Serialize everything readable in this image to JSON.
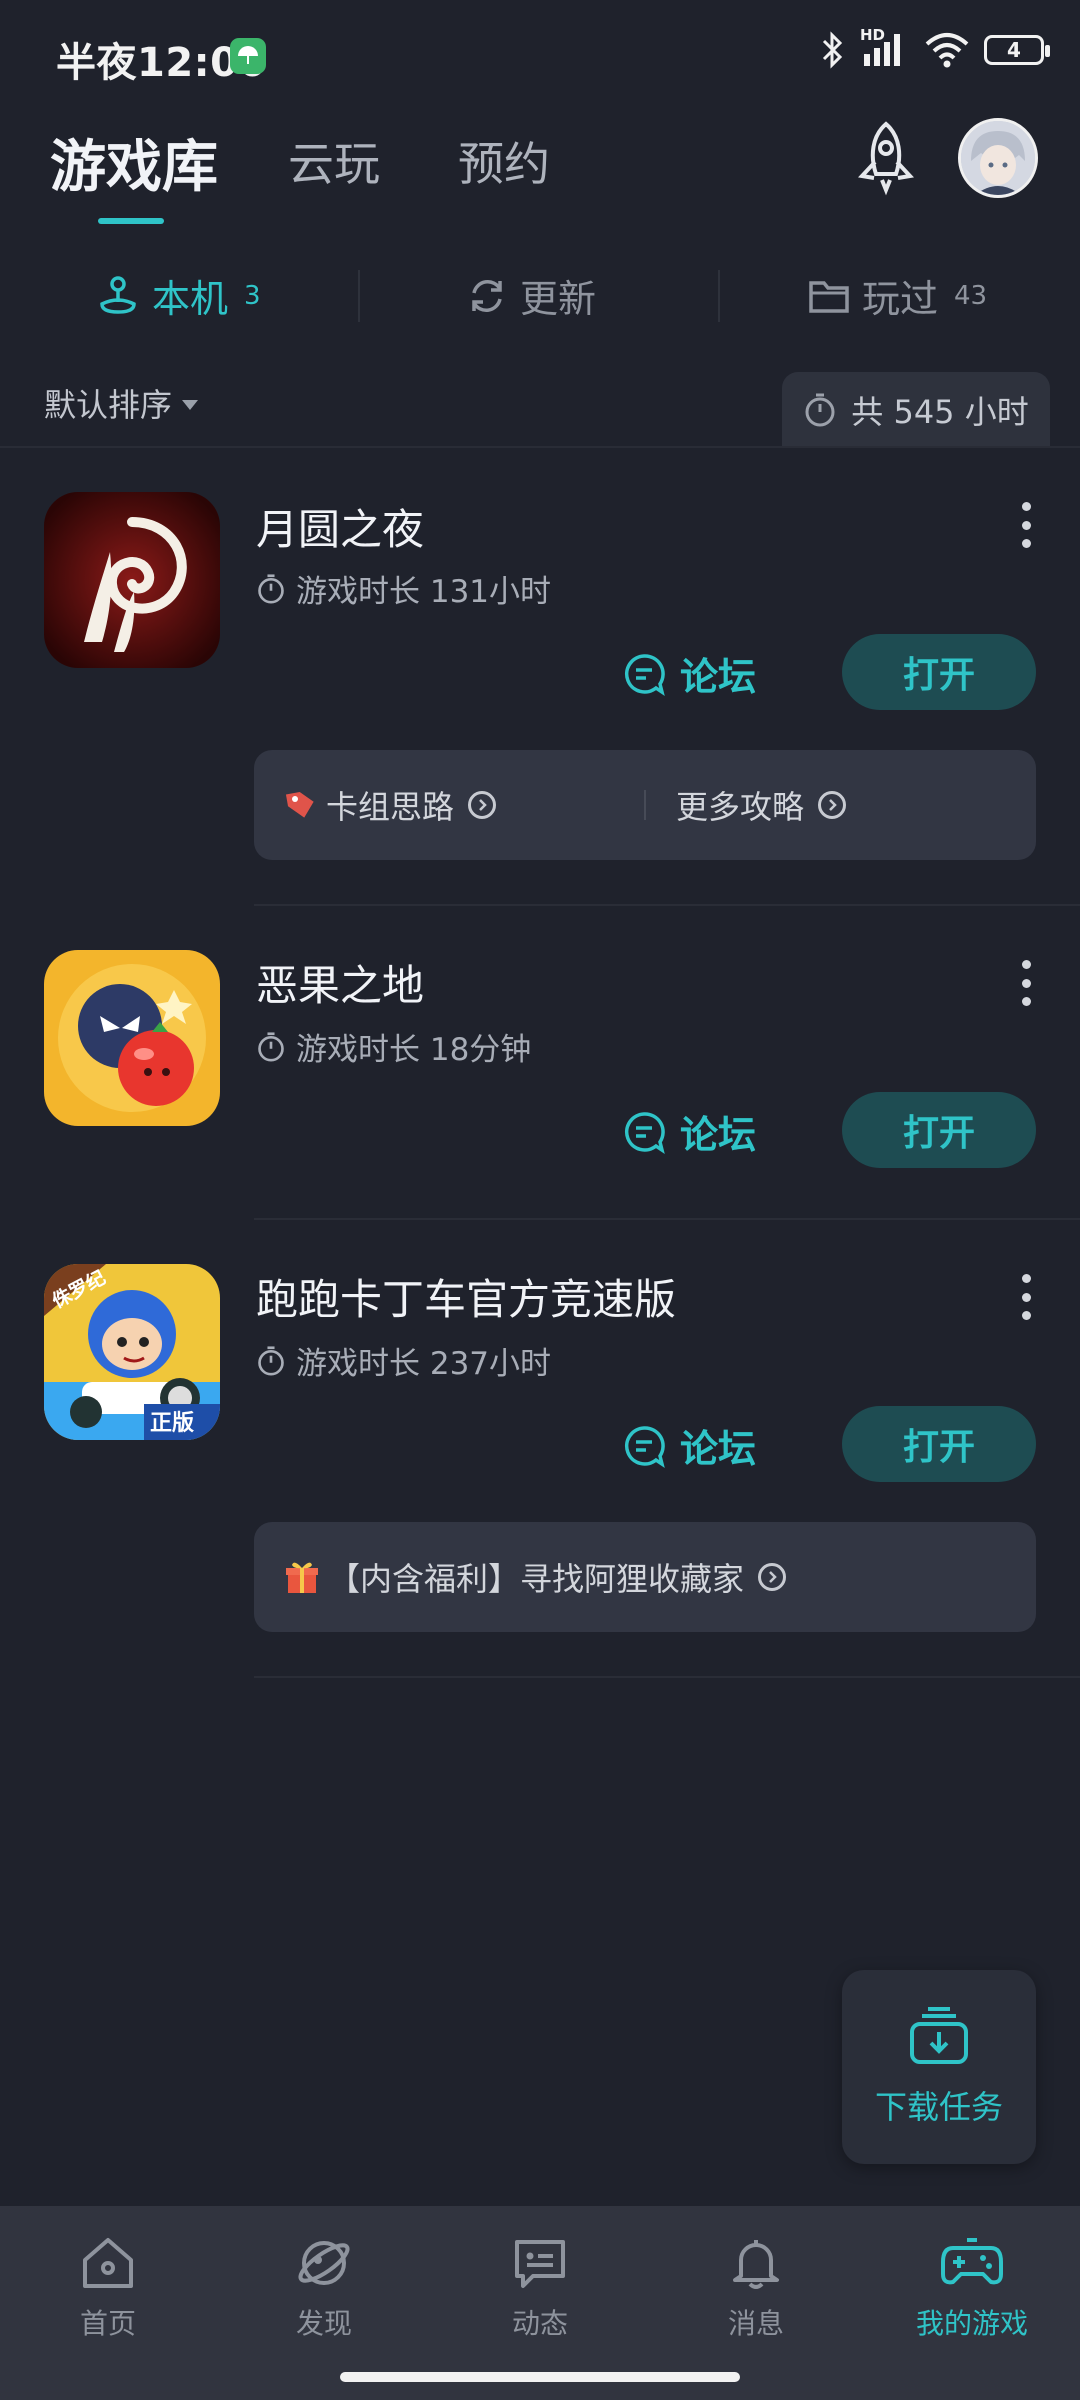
{
  "status_bar": {
    "time": "半夜12:00",
    "network_hd": "HD",
    "battery": "4"
  },
  "top_tabs": [
    {
      "label": "游戏库",
      "active": true
    },
    {
      "label": "云玩",
      "active": false
    },
    {
      "label": "预约",
      "active": false
    }
  ],
  "sub_tabs": [
    {
      "label": "本机",
      "count": "3",
      "icon": "joystick-icon",
      "active": true
    },
    {
      "label": "更新",
      "count": "",
      "icon": "refresh-icon",
      "active": false
    },
    {
      "label": "玩过",
      "count": "43",
      "icon": "folder-icon",
      "active": false
    }
  ],
  "sort": {
    "label": "默认排序"
  },
  "total": {
    "label": "共 545 小时"
  },
  "games": [
    {
      "title": "月圆之夜",
      "playtime": "游戏时长 131小时",
      "forum_label": "论坛",
      "open_label": "打开",
      "extras": [
        {
          "label": "卡组思路"
        },
        {
          "label": "更多攻略"
        }
      ]
    },
    {
      "title": "恶果之地",
      "playtime": "游戏时长 18分钟",
      "forum_label": "论坛",
      "open_label": "打开"
    },
    {
      "title": "跑跑卡丁车官方竞速版",
      "playtime": "游戏时长 237小时",
      "forum_label": "论坛",
      "open_label": "打开",
      "icon_badges": [
        "侏罗纪",
        "正版"
      ],
      "promo": "【内含福利】寻找阿狸收藏家"
    }
  ],
  "fab": {
    "label": "下载任务"
  },
  "bottom_nav": [
    {
      "label": "首页",
      "icon": "home-icon",
      "active": false
    },
    {
      "label": "发现",
      "icon": "planet-icon",
      "active": false
    },
    {
      "label": "动态",
      "icon": "chat-icon",
      "active": false
    },
    {
      "label": "消息",
      "icon": "bell-icon",
      "active": false
    },
    {
      "label": "我的游戏",
      "icon": "gamepad-icon",
      "active": true
    }
  ],
  "colors": {
    "accent": "#2fc4c8",
    "background": "#1f222c",
    "button_bg": "#1e4c52"
  }
}
